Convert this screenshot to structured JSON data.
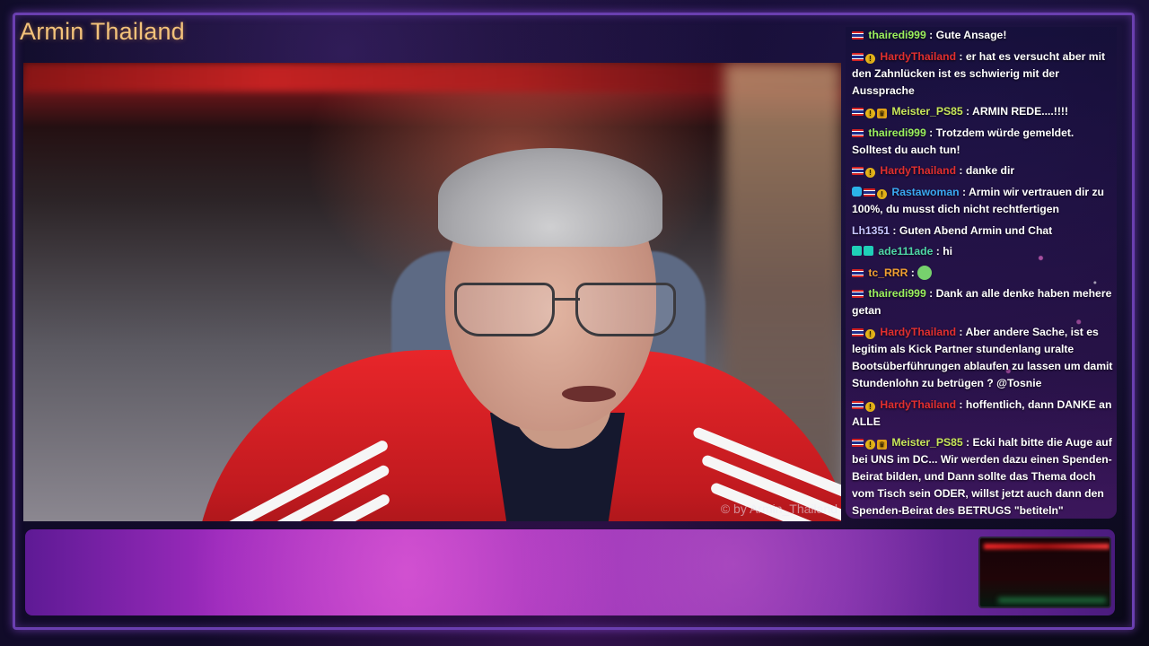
{
  "stream": {
    "channel_title": "Armin Thailand",
    "watermark": "© by Armin_Thailand"
  },
  "chat": {
    "messages": [
      {
        "badges": [
          "flag"
        ],
        "user": "thairedi999",
        "color": "#9bf05e",
        "text": "Gute Ansage!"
      },
      {
        "badges": [
          "flag",
          "sub"
        ],
        "user": "HardyThailand",
        "color": "#e12f2f",
        "text": "er hat es versucht aber mit den Zahnlücken ist es schwierig mit der Aussprache"
      },
      {
        "badges": [
          "flag",
          "sub",
          "crown"
        ],
        "user": "Meister_PS85",
        "color": "#c7e65a",
        "text": "ARMIN REDE....!!!!"
      },
      {
        "badges": [
          "flag"
        ],
        "user": "thairedi999",
        "color": "#9bf05e",
        "text": "Trotzdem würde gemeldet. Solltest du auch tun!"
      },
      {
        "badges": [
          "flag",
          "sub"
        ],
        "user": "HardyThailand",
        "color": "#e12f2f",
        "text": "danke dir"
      },
      {
        "badges": [
          "verified",
          "flag",
          "sub"
        ],
        "user": "Rastawoman",
        "color": "#3aa8f0",
        "text": "Armin wir vertrauen dir zu 100%, du musst dich nicht rechtfertigen"
      },
      {
        "badges": [],
        "user": "Lh1351",
        "color": "#c7c7ff",
        "text": "Guten Abend Armin und Chat"
      },
      {
        "badges": [
          "og",
          "og"
        ],
        "user": "ade111ade",
        "color": "#4fd6a6",
        "text": "hi"
      },
      {
        "badges": [
          "flag"
        ],
        "user": "tc_RRR",
        "color": "#f0a030",
        "text": "",
        "emote": "alien-emote-icon"
      },
      {
        "badges": [
          "flag"
        ],
        "user": "thairedi999",
        "color": "#9bf05e",
        "text": "Dank an alle denke haben mehere getan"
      },
      {
        "badges": [
          "flag",
          "sub"
        ],
        "user": "HardyThailand",
        "color": "#e12f2f",
        "text": "Aber andere Sache, ist es legitim als Kick Partner stundenlang uralte Bootsüberführungen ablaufen zu lassen um damit Stundenlohn zu betrügen ? @Tosnie"
      },
      {
        "badges": [
          "flag",
          "sub"
        ],
        "user": "HardyThailand",
        "color": "#e12f2f",
        "text": "hoffentlich, dann DANKE an ALLE"
      },
      {
        "badges": [
          "flag",
          "sub",
          "crown"
        ],
        "user": "Meister_PS85",
        "color": "#c7e65a",
        "text": "Ecki halt bitte die Auge auf bei UNS im DC... Wir werden dazu einen Spenden-Beirat bilden, und Dann sollte das Thema doch vom Tisch sein ODER, willst jetzt auch dann den Spenden-Beirat des BETRUGS \"betiteln\""
      }
    ]
  },
  "colors": {
    "title": "#f3c27a",
    "frame_border": "#6a3fb0",
    "banner": "#9e2bbd"
  }
}
